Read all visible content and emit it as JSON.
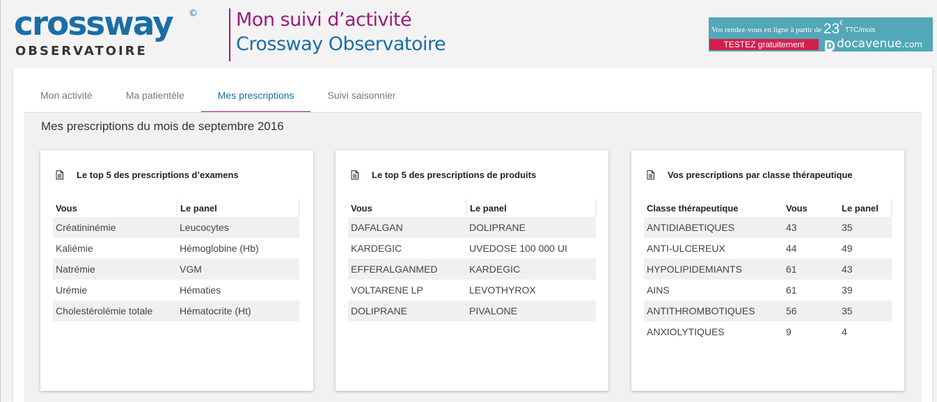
{
  "brand": {
    "word": "crossway",
    "reg": "©",
    "subtitle": "OBSERVATOIRE"
  },
  "header": {
    "title": "Mon suivi d’activité",
    "subtitle": "Crossway Observatoire"
  },
  "ad": {
    "pre": "Vos rendez-vous en ligne à partir de",
    "price": "23",
    "currency": "€",
    "suffix": "TTC/mois",
    "cta": "TESTEZ gratuitement",
    "brand_main": "docavenue",
    "brand_tld": ".com",
    "color_bg": "#52a7b8",
    "color_cta": "#d1204c"
  },
  "tabs": [
    {
      "label": "Mon activité",
      "active": false
    },
    {
      "label": "Ma patientèle",
      "active": false
    },
    {
      "label": "Mes prescriptions",
      "active": true
    },
    {
      "label": "Suivi saisonnier",
      "active": false
    }
  ],
  "page_title": "Mes prescriptions du mois de septembre 2016",
  "cards": [
    {
      "title": "Le top 5 des prescriptions d’examens",
      "icon": "document-icon",
      "headers": [
        "Vous",
        "Le panel"
      ],
      "rows": [
        [
          "Créatininémie",
          "Leucocytes"
        ],
        [
          "Kaliémie",
          "Hémoglobine (Hb)"
        ],
        [
          "Natrémie",
          "VGM"
        ],
        [
          "Urémie",
          "Hématies"
        ],
        [
          "Cholestérolémie totale",
          "Hématocrite (Ht)"
        ]
      ]
    },
    {
      "title": "Le top 5 des prescriptions de produits",
      "icon": "document-icon",
      "headers": [
        "Vous",
        "Le panel"
      ],
      "rows": [
        [
          "DAFALGAN",
          "DOLIPRANE"
        ],
        [
          "KARDEGIC",
          "UVEDOSE 100 000 UI"
        ],
        [
          "EFFERALGANMED",
          "KARDEGIC"
        ],
        [
          "VOLTARENE LP",
          "LEVOTHYROX"
        ],
        [
          "DOLIPRANE",
          "PIVALONE"
        ]
      ]
    },
    {
      "title": "Vos prescriptions par classe thérapeutique",
      "icon": "document-icon",
      "headers": [
        "Classe thérapeutique",
        "Vous",
        "Le panel"
      ],
      "rows": [
        [
          "ANTIDIABETIQUES",
          "43",
          "35"
        ],
        [
          "ANTI-ULCEREUX",
          "44",
          "49"
        ],
        [
          "HYPOLIPIDEMIANTS",
          "61",
          "43"
        ],
        [
          "AINS",
          "61",
          "39"
        ],
        [
          "ANTITHROMBOTIQUES",
          "56",
          "35"
        ],
        [
          "ANXIOLYTIQUES",
          "9",
          "4"
        ]
      ]
    }
  ],
  "colors": {
    "brand_blue": "#1a6ea6",
    "brand_purple": "#9b1a7e"
  }
}
